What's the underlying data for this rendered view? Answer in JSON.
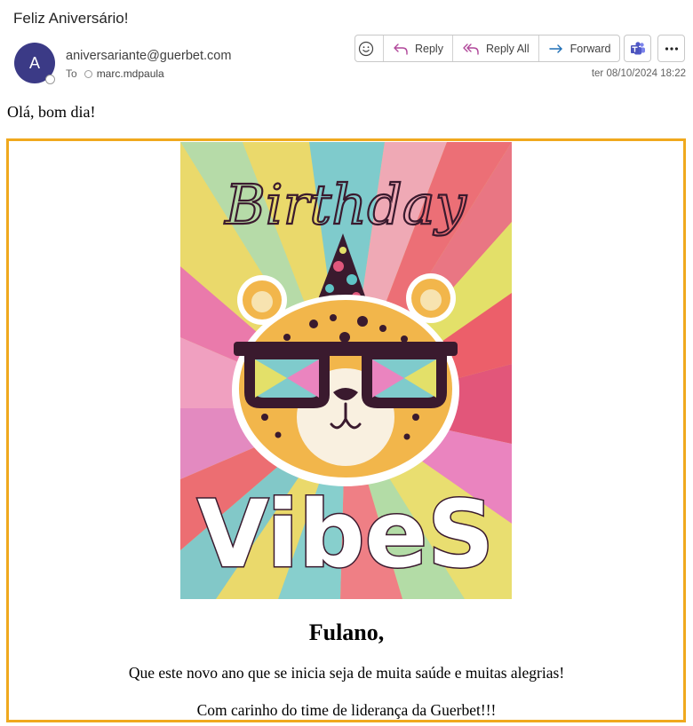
{
  "email": {
    "subject": "Feliz Aniversário!",
    "avatar_letter": "A",
    "sender": "aniversariante@guerbet.com",
    "to_label": "To",
    "recipient": "marc.mdpaula",
    "timestamp": "ter 08/10/2024 18:22"
  },
  "toolbar": {
    "reply_label": "Reply",
    "reply_all_label": "Reply All",
    "forward_label": "Forward",
    "icons": [
      "emoji-icon",
      "reply-icon",
      "reply-all-icon",
      "forward-icon",
      "teams-icon",
      "more-icon"
    ]
  },
  "body": {
    "greeting": "Olá, bom dia!",
    "card": {
      "headline_script": "Birthday",
      "headline_bold": "VibeS",
      "name": "Fulano,",
      "wish": "Que este novo ano que se inicia seja de muita saúde e muitas alegrias!",
      "signature": "Com carinho do time de liderança da Guerbet!!!"
    }
  },
  "colors": {
    "avatar": "#3b3a86",
    "frame": "#f0a91e",
    "teams": "#4b53bc"
  }
}
